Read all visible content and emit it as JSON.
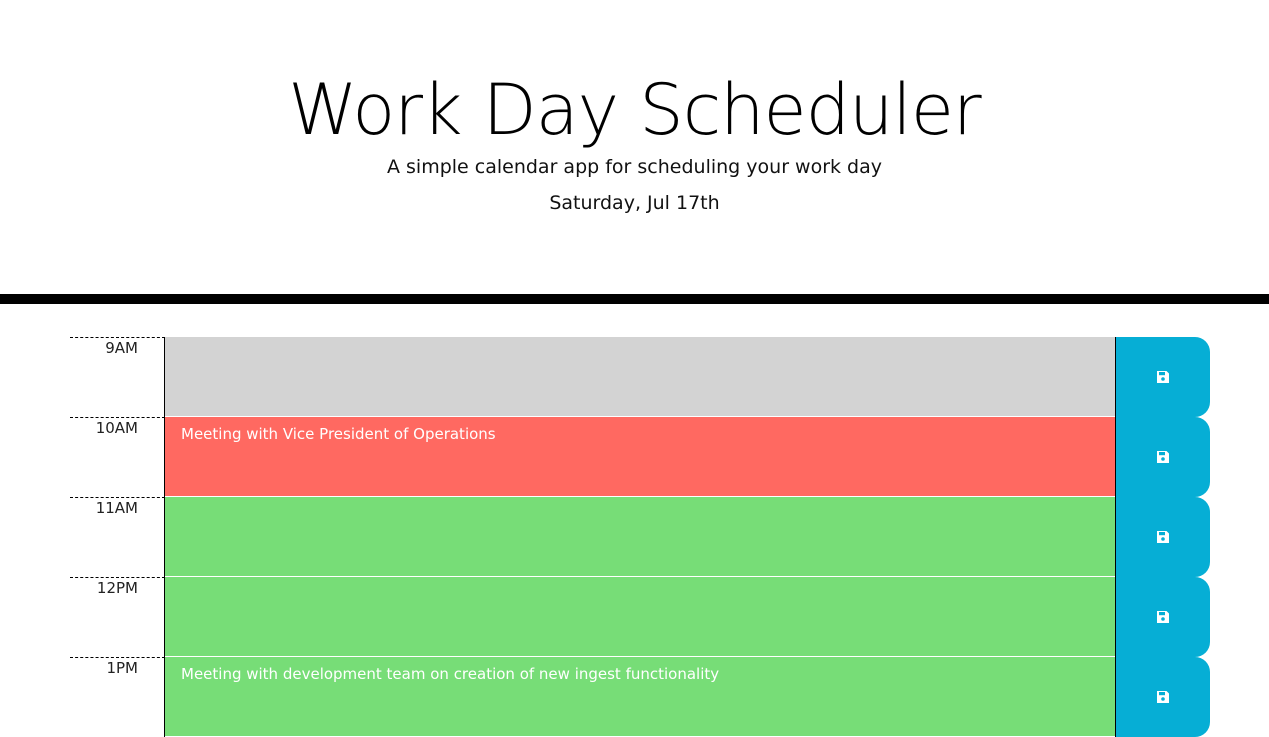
{
  "header": {
    "title": "Work Day Scheduler",
    "subtitle": "A simple calendar app for scheduling your work day",
    "current_day": "Saturday, Jul 17th"
  },
  "colors": {
    "past": "#d3d3d3",
    "present": "#ff6961",
    "future": "#77dd77",
    "save_button": "#06aed5"
  },
  "time_blocks": [
    {
      "hour": "9AM",
      "description": "",
      "status": "past",
      "save_icon": "save-icon"
    },
    {
      "hour": "10AM",
      "description": "Meeting with Vice President of Operations",
      "status": "present",
      "save_icon": "save-icon"
    },
    {
      "hour": "11AM",
      "description": "",
      "status": "future",
      "save_icon": "save-icon"
    },
    {
      "hour": "12PM",
      "description": "",
      "status": "future",
      "save_icon": "save-icon"
    },
    {
      "hour": "1PM",
      "description": "Meeting with development team on creation of new ingest functionality",
      "status": "future",
      "save_icon": "save-icon"
    }
  ]
}
